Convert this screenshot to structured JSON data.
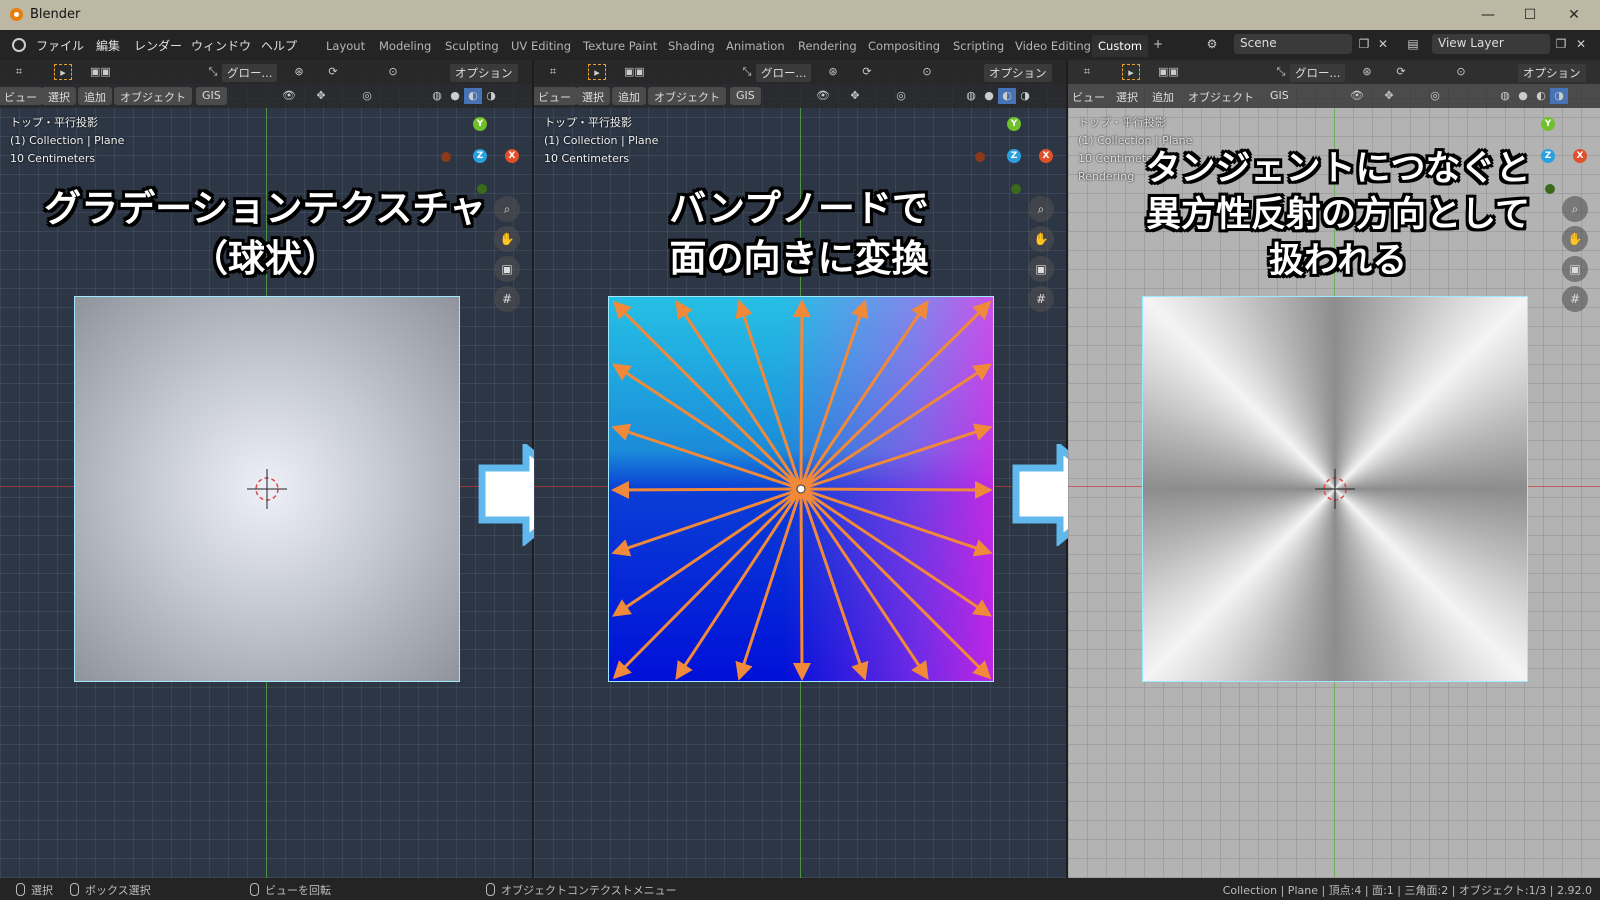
{
  "window": {
    "title": "Blender",
    "controls": [
      "—",
      "☐",
      "✕"
    ]
  },
  "menu": [
    "ファイル",
    "編集",
    "レンダー",
    "ウィンドウ",
    "ヘルプ"
  ],
  "workspace_tabs": [
    "Layout",
    "Modeling",
    "Sculpting",
    "UV Editing",
    "Texture Paint",
    "Shading",
    "Animation",
    "Rendering",
    "Compositing",
    "Scripting",
    "Video Editing",
    "Custom"
  ],
  "active_tab": "Custom",
  "add_tab": "+",
  "scene": "Scene",
  "view_layer": "View Layer",
  "viewport_header": {
    "transform": "グロー...",
    "options": "オプション",
    "menus": [
      "ビュー",
      "選択",
      "追加",
      "オブジェクト",
      "GIS"
    ]
  },
  "viewport_info": {
    "view": "トップ・平行投影",
    "collection": "(1) Collection | Plane",
    "scale": "10 Centimeters",
    "rendering": "Rendering"
  },
  "gizmo": {
    "y": "Y",
    "z": "Z",
    "x": "X"
  },
  "captions": {
    "left": [
      "グラデーションテクスチャ",
      "（球状）"
    ],
    "middle": [
      "バンプノードで",
      "面の向きに変換"
    ],
    "right": [
      "タンジェントにつなぐと",
      "異方性反射の方向として",
      "扱われる"
    ]
  },
  "status": {
    "select": "選択",
    "box_select": "ボックス選択",
    "rotate_view": "ビューを回転",
    "context_menu": "オブジェクトコンテクストメニュー",
    "stats": "Collection | Plane | 頂点:4 | 面:1 | 三角面:2 | オブジェクト:1/3 | 2.92.0"
  },
  "colors": {
    "arrow": "#f08a3a",
    "plane_outline": "#9fe9ff",
    "flow_arrow": "#60b8ec",
    "grid_dark": "#2c3644",
    "grid_light": "#b3b3b3"
  }
}
